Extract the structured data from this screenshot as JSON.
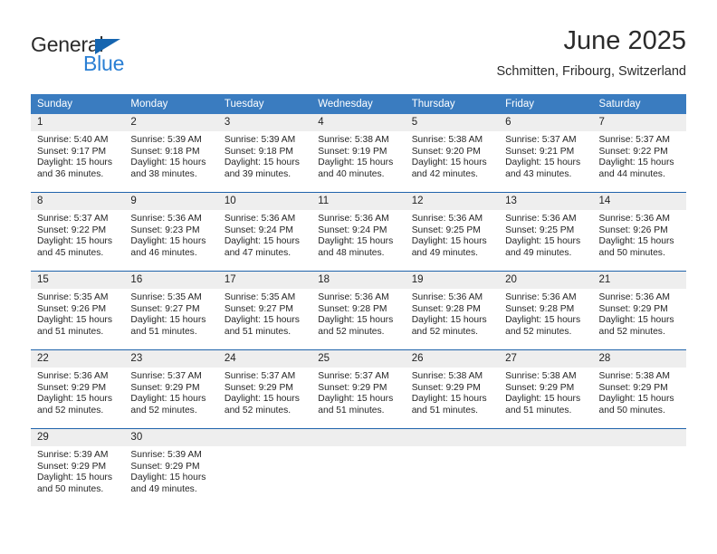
{
  "brand": {
    "name_top": "General",
    "name_bottom": "Blue",
    "accent_color": "#2a7fd4",
    "triangle_color": "#1565b0"
  },
  "header": {
    "title": "June 2025",
    "subtitle": "Schmitten, Fribourg, Switzerland"
  },
  "theme": {
    "header_bg": "#3a7cc0",
    "week_divider": "#1f63ab",
    "daynum_bg": "#eeeeee"
  },
  "calendar": {
    "weekday_headers": [
      "Sunday",
      "Monday",
      "Tuesday",
      "Wednesday",
      "Thursday",
      "Friday",
      "Saturday"
    ],
    "weeks": [
      [
        {
          "day": "1",
          "sunrise": "Sunrise: 5:40 AM",
          "sunset": "Sunset: 9:17 PM",
          "daylight": "Daylight: 15 hours and 36 minutes."
        },
        {
          "day": "2",
          "sunrise": "Sunrise: 5:39 AM",
          "sunset": "Sunset: 9:18 PM",
          "daylight": "Daylight: 15 hours and 38 minutes."
        },
        {
          "day": "3",
          "sunrise": "Sunrise: 5:39 AM",
          "sunset": "Sunset: 9:18 PM",
          "daylight": "Daylight: 15 hours and 39 minutes."
        },
        {
          "day": "4",
          "sunrise": "Sunrise: 5:38 AM",
          "sunset": "Sunset: 9:19 PM",
          "daylight": "Daylight: 15 hours and 40 minutes."
        },
        {
          "day": "5",
          "sunrise": "Sunrise: 5:38 AM",
          "sunset": "Sunset: 9:20 PM",
          "daylight": "Daylight: 15 hours and 42 minutes."
        },
        {
          "day": "6",
          "sunrise": "Sunrise: 5:37 AM",
          "sunset": "Sunset: 9:21 PM",
          "daylight": "Daylight: 15 hours and 43 minutes."
        },
        {
          "day": "7",
          "sunrise": "Sunrise: 5:37 AM",
          "sunset": "Sunset: 9:22 PM",
          "daylight": "Daylight: 15 hours and 44 minutes."
        }
      ],
      [
        {
          "day": "8",
          "sunrise": "Sunrise: 5:37 AM",
          "sunset": "Sunset: 9:22 PM",
          "daylight": "Daylight: 15 hours and 45 minutes."
        },
        {
          "day": "9",
          "sunrise": "Sunrise: 5:36 AM",
          "sunset": "Sunset: 9:23 PM",
          "daylight": "Daylight: 15 hours and 46 minutes."
        },
        {
          "day": "10",
          "sunrise": "Sunrise: 5:36 AM",
          "sunset": "Sunset: 9:24 PM",
          "daylight": "Daylight: 15 hours and 47 minutes."
        },
        {
          "day": "11",
          "sunrise": "Sunrise: 5:36 AM",
          "sunset": "Sunset: 9:24 PM",
          "daylight": "Daylight: 15 hours and 48 minutes."
        },
        {
          "day": "12",
          "sunrise": "Sunrise: 5:36 AM",
          "sunset": "Sunset: 9:25 PM",
          "daylight": "Daylight: 15 hours and 49 minutes."
        },
        {
          "day": "13",
          "sunrise": "Sunrise: 5:36 AM",
          "sunset": "Sunset: 9:25 PM",
          "daylight": "Daylight: 15 hours and 49 minutes."
        },
        {
          "day": "14",
          "sunrise": "Sunrise: 5:36 AM",
          "sunset": "Sunset: 9:26 PM",
          "daylight": "Daylight: 15 hours and 50 minutes."
        }
      ],
      [
        {
          "day": "15",
          "sunrise": "Sunrise: 5:35 AM",
          "sunset": "Sunset: 9:26 PM",
          "daylight": "Daylight: 15 hours and 51 minutes."
        },
        {
          "day": "16",
          "sunrise": "Sunrise: 5:35 AM",
          "sunset": "Sunset: 9:27 PM",
          "daylight": "Daylight: 15 hours and 51 minutes."
        },
        {
          "day": "17",
          "sunrise": "Sunrise: 5:35 AM",
          "sunset": "Sunset: 9:27 PM",
          "daylight": "Daylight: 15 hours and 51 minutes."
        },
        {
          "day": "18",
          "sunrise": "Sunrise: 5:36 AM",
          "sunset": "Sunset: 9:28 PM",
          "daylight": "Daylight: 15 hours and 52 minutes."
        },
        {
          "day": "19",
          "sunrise": "Sunrise: 5:36 AM",
          "sunset": "Sunset: 9:28 PM",
          "daylight": "Daylight: 15 hours and 52 minutes."
        },
        {
          "day": "20",
          "sunrise": "Sunrise: 5:36 AM",
          "sunset": "Sunset: 9:28 PM",
          "daylight": "Daylight: 15 hours and 52 minutes."
        },
        {
          "day": "21",
          "sunrise": "Sunrise: 5:36 AM",
          "sunset": "Sunset: 9:29 PM",
          "daylight": "Daylight: 15 hours and 52 minutes."
        }
      ],
      [
        {
          "day": "22",
          "sunrise": "Sunrise: 5:36 AM",
          "sunset": "Sunset: 9:29 PM",
          "daylight": "Daylight: 15 hours and 52 minutes."
        },
        {
          "day": "23",
          "sunrise": "Sunrise: 5:37 AM",
          "sunset": "Sunset: 9:29 PM",
          "daylight": "Daylight: 15 hours and 52 minutes."
        },
        {
          "day": "24",
          "sunrise": "Sunrise: 5:37 AM",
          "sunset": "Sunset: 9:29 PM",
          "daylight": "Daylight: 15 hours and 52 minutes."
        },
        {
          "day": "25",
          "sunrise": "Sunrise: 5:37 AM",
          "sunset": "Sunset: 9:29 PM",
          "daylight": "Daylight: 15 hours and 51 minutes."
        },
        {
          "day": "26",
          "sunrise": "Sunrise: 5:38 AM",
          "sunset": "Sunset: 9:29 PM",
          "daylight": "Daylight: 15 hours and 51 minutes."
        },
        {
          "day": "27",
          "sunrise": "Sunrise: 5:38 AM",
          "sunset": "Sunset: 9:29 PM",
          "daylight": "Daylight: 15 hours and 51 minutes."
        },
        {
          "day": "28",
          "sunrise": "Sunrise: 5:38 AM",
          "sunset": "Sunset: 9:29 PM",
          "daylight": "Daylight: 15 hours and 50 minutes."
        }
      ],
      [
        {
          "day": "29",
          "sunrise": "Sunrise: 5:39 AM",
          "sunset": "Sunset: 9:29 PM",
          "daylight": "Daylight: 15 hours and 50 minutes."
        },
        {
          "day": "30",
          "sunrise": "Sunrise: 5:39 AM",
          "sunset": "Sunset: 9:29 PM",
          "daylight": "Daylight: 15 hours and 49 minutes."
        },
        {
          "day": "",
          "sunrise": "",
          "sunset": "",
          "daylight": ""
        },
        {
          "day": "",
          "sunrise": "",
          "sunset": "",
          "daylight": ""
        },
        {
          "day": "",
          "sunrise": "",
          "sunset": "",
          "daylight": ""
        },
        {
          "day": "",
          "sunrise": "",
          "sunset": "",
          "daylight": ""
        },
        {
          "day": "",
          "sunrise": "",
          "sunset": "",
          "daylight": ""
        }
      ]
    ]
  }
}
